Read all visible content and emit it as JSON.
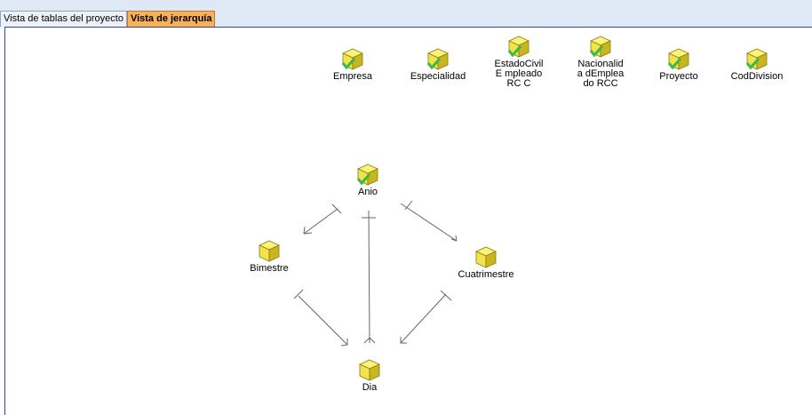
{
  "tabs": [
    {
      "label": "Vista de tablas del proyecto",
      "active": false
    },
    {
      "label": "Vista de jerarquía",
      "active": true
    }
  ],
  "top_tables": [
    {
      "name": "Empresa",
      "icon": "cube-check-icon"
    },
    {
      "name": "Especialidad",
      "icon": "cube-check-icon"
    },
    {
      "name": "EstadoCivilE mpleadoRC C",
      "icon": "cube-check-icon"
    },
    {
      "name": "Nacionalida dEmpleado RCC",
      "icon": "cube-check-icon"
    },
    {
      "name": "Proyecto",
      "icon": "cube-check-icon"
    },
    {
      "name": "CodDivision",
      "icon": "cube-check-icon"
    }
  ],
  "hierarchy": {
    "anio": "Anio",
    "bimestre": "Bimestre",
    "cuatrimestre": "Cuatrimestre",
    "dia": "Dia"
  },
  "colors": {
    "cube": "#f2e34a",
    "check": "#3cb84a",
    "active_tab": "#f7b15c"
  }
}
